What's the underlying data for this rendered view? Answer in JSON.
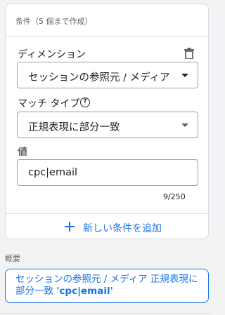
{
  "condition_card": {
    "header": "条件（5 個まで作成）",
    "dimension": {
      "label": "ディメンション",
      "selected": "セッションの参照元 / メディア"
    },
    "match_type": {
      "label": "マッチ タイプ",
      "selected": "正規表現に部分一致"
    },
    "value": {
      "label": "値",
      "input": "cpc|email",
      "counter": "9/250"
    },
    "add_condition_label": "新しい条件を追加"
  },
  "summary": {
    "label": "概要",
    "prefix": "セッションの参照元 / メディア 正規表現に部分一致 ",
    "value": "'cpc|email'"
  },
  "icons": {
    "delete": "trash-icon",
    "help": "help-icon",
    "add": "plus-icon",
    "dropdown": "chevron-down-icon"
  },
  "colors": {
    "accent": "#1a73e8",
    "border": "#9aa0a6",
    "text": "#202124"
  }
}
